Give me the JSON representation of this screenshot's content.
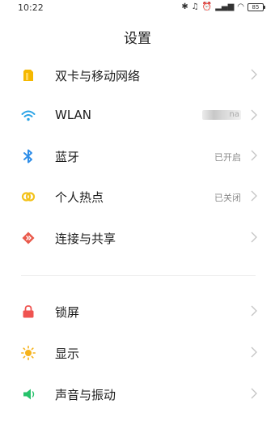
{
  "status_bar": {
    "time": "10:22",
    "battery": "85"
  },
  "page": {
    "title": "设置"
  },
  "connectivity": [
    {
      "label": "双卡与移动网络",
      "value": "",
      "icon": "sim-card-icon"
    },
    {
      "label": "WLAN",
      "value": "na",
      "icon": "wifi-icon"
    },
    {
      "label": "蓝牙",
      "value": "已开启",
      "icon": "bluetooth-icon"
    },
    {
      "label": "个人热点",
      "value": "已关闭",
      "icon": "hotspot-icon"
    },
    {
      "label": "连接与共享",
      "value": "",
      "icon": "connection-share-icon"
    }
  ],
  "system": [
    {
      "label": "锁屏",
      "icon": "lock-icon"
    },
    {
      "label": "显示",
      "icon": "sun-icon"
    },
    {
      "label": "声音与振动",
      "icon": "speaker-icon"
    }
  ],
  "colors": {
    "sim": "#f5b800",
    "wifi": "#2aa3e6",
    "bluetooth": "#2f8ee8",
    "hotspot": "#f3c21b",
    "share": "#e9594b",
    "lock": "#ef5350",
    "sun": "#f6b21a",
    "speaker": "#27c26b"
  }
}
